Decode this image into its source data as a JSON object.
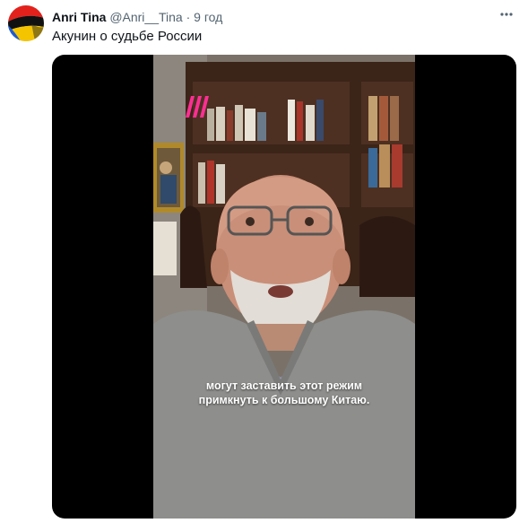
{
  "tweet": {
    "author_name": "Anri Tina",
    "author_handle": "@Anri__Tina",
    "separator": "·",
    "time": "9 год",
    "more_icon": "more-dots-icon",
    "text": "Акунин о судьбе России"
  },
  "video": {
    "channel_logo_icon": "dozhd-logo-icon",
    "subtitle_lines": [
      "могут заставить этот режим",
      "примкнуть к большому Китаю."
    ]
  }
}
